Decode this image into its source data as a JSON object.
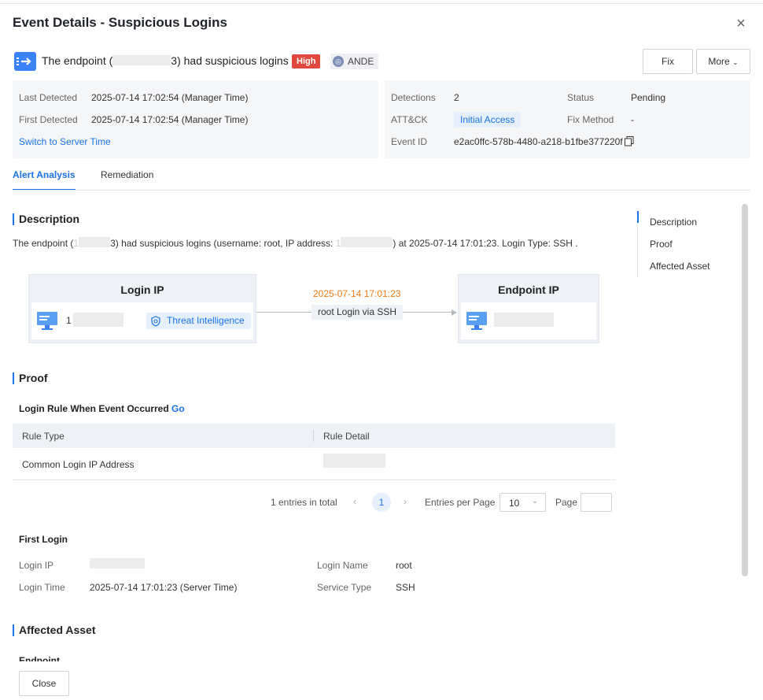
{
  "header": {
    "title": "Event Details - Suspicious Logins",
    "close_glyph": "×"
  },
  "event": {
    "headline_prefix": "The endpoint (",
    "headline_suffix": "3) had suspicious logins",
    "severity": "High",
    "engine_badge": "ANDE",
    "fix_label": "Fix",
    "more_label": "More",
    "icon": "arrow-right-icon"
  },
  "summary_left": {
    "last_detected_label": "Last Detected",
    "last_detected_value": "2025-07-14 17:02:54 (Manager Time)",
    "first_detected_label": "First Detected",
    "first_detected_value": "2025-07-14 17:02:54 (Manager Time)",
    "switch_link": "Switch to Server Time"
  },
  "summary_right": {
    "detections_label": "Detections",
    "detections_value": "2",
    "status_label": "Status",
    "status_value": "Pending",
    "attck_label": "ATT&CK",
    "attck_value": "Initial Access",
    "fix_method_label": "Fix Method",
    "fix_method_value": "-",
    "event_id_label": "Event ID",
    "event_id_value": "e2ac0ffc-578b-4480-a218-b1fbe377220f"
  },
  "tabs": [
    "Alert Analysis",
    "Remediation"
  ],
  "anchors": [
    "Description",
    "Proof",
    "Affected Asset"
  ],
  "description": {
    "title": "Description",
    "text_a": "The endpoint (",
    "text_a2": "1",
    "text_b": "3) had suspicious logins (username: root, IP address: ",
    "text_b2": "1",
    "text_c": ") at 2025-07-14 17:01:23. Login Type: SSH ."
  },
  "flow": {
    "login_ip_title": "Login IP",
    "login_ip_prefix": "1",
    "threat_intel": "Threat Intelligence",
    "timestamp": "2025-07-14 17:01:23",
    "action": "root Login via SSH",
    "endpoint_ip_title": "Endpoint IP"
  },
  "proof": {
    "title": "Proof",
    "rule_heading": "Login Rule When Event Occurred",
    "go_link": "Go",
    "columns": [
      "Rule Type",
      "Rule Detail"
    ],
    "rows": [
      {
        "type": "Common Login IP Address"
      }
    ],
    "pagination": {
      "total": "1 entries in total",
      "current_page": "1",
      "per_page_label": "Entries per Page",
      "per_page_value": "10",
      "page_label": "Page"
    }
  },
  "first_login": {
    "heading": "First Login",
    "login_ip_label": "Login IP",
    "login_name_label": "Login Name",
    "login_name_value": "root",
    "login_time_label": "Login Time",
    "login_time_value": "2025-07-14 17:01:23 (Server Time)",
    "service_type_label": "Service Type",
    "service_type_value": "SSH"
  },
  "affected_asset": {
    "title": "Affected Asset",
    "sub": "Endpoint"
  },
  "footer": {
    "close_label": "Close"
  },
  "colors": {
    "accent": "#1a73e8",
    "high": "#e0483e",
    "timestamp": "#f07b17"
  }
}
